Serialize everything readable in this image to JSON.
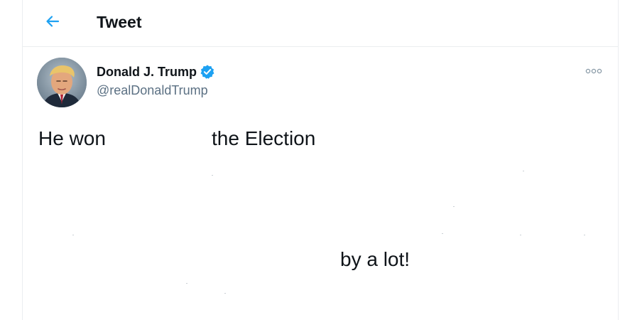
{
  "header": {
    "back_icon": "arrow-left-icon",
    "title": "Tweet"
  },
  "tweet": {
    "author": {
      "display_name": "Donald J. Trump",
      "handle": "@realDonaldTrump",
      "verified": true,
      "verified_icon": "verified-badge-icon"
    },
    "more_icon": "more-options-icon",
    "text_fragments": [
      "He won",
      "the Election",
      "by a lot!"
    ]
  },
  "colors": {
    "accent": "#1da1f2",
    "text_primary": "#0f1419",
    "text_secondary": "#5b7083",
    "border": "#ebeef0"
  }
}
